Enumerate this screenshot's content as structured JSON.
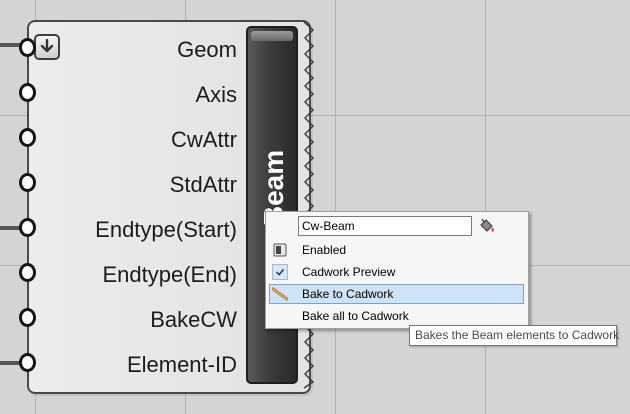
{
  "component": {
    "name": "Beam",
    "bake_icon": "down-arrow-icon",
    "inputs": [
      {
        "label": "Geom"
      },
      {
        "label": "Axis"
      },
      {
        "label": "CwAttr"
      },
      {
        "label": "StdAttr"
      },
      {
        "label": "Endtype(Start)"
      },
      {
        "label": "Endtype(End)"
      },
      {
        "label": "BakeCW"
      },
      {
        "label": "Element-ID"
      }
    ]
  },
  "context_menu": {
    "name_field_value": "Cw-Beam",
    "items": [
      {
        "label": "Enabled",
        "icon": "enabled-icon"
      },
      {
        "label": "Cadwork Preview",
        "icon": "checkmark-icon",
        "checked": true
      },
      {
        "label": "Bake to Cadwork",
        "icon": "pencil-icon",
        "highlighted": true
      },
      {
        "label": "Bake all to Cadwork",
        "icon": ""
      }
    ]
  },
  "tooltip": {
    "text": "Bakes the Beam elements to Cadwork"
  },
  "colors": {
    "canvas": "#d4d4d4",
    "panel": "#2a2a2a",
    "highlight": "#cfe3f7"
  }
}
